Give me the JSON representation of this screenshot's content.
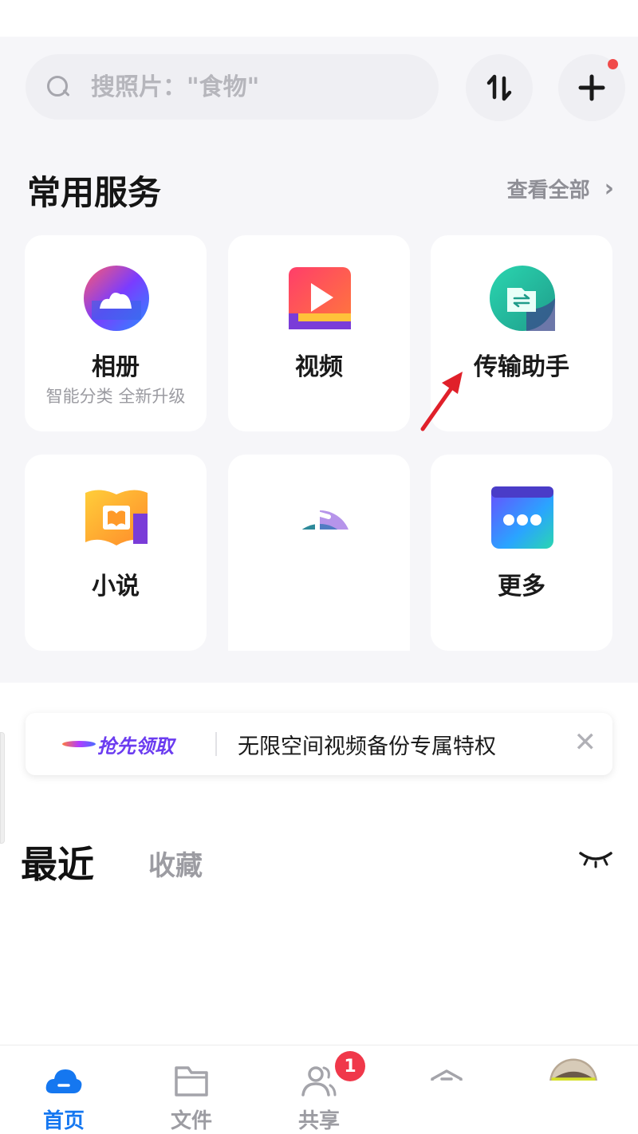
{
  "search": {
    "placeholder": "搜照片：\"食物\""
  },
  "header": {
    "sort_icon": "sort-arrows-icon",
    "add_icon": "plus-icon",
    "add_badge_color": "#f04a4a"
  },
  "services": {
    "title": "常用服务",
    "view_all": "查看全部",
    "items": [
      {
        "name": "相册",
        "sub": "智能分类 全新升级",
        "icon": "album-icon"
      },
      {
        "name": "视频",
        "sub": "",
        "icon": "video-icon"
      },
      {
        "name": "传输助手",
        "sub": "",
        "icon": "transfer-icon"
      },
      {
        "name": "小说",
        "sub": "",
        "icon": "novel-icon"
      },
      {
        "name": "",
        "sub": "",
        "icon": "music-icon"
      },
      {
        "name": "更多",
        "sub": "",
        "icon": "more-icon"
      }
    ]
  },
  "banner": {
    "brand": "抢先领取",
    "text": "无限空间视频备份专属特权",
    "close": "✕"
  },
  "recent_tabs": {
    "recent": "最近",
    "favorites": "收藏"
  },
  "bottom_nav": {
    "items": [
      {
        "label": "首页",
        "icon": "home-cloud-icon",
        "active": true
      },
      {
        "label": "文件",
        "icon": "folder-icon",
        "active": false
      },
      {
        "label": "共享",
        "icon": "share-people-icon",
        "active": false
      },
      {
        "label": "",
        "icon": "box-icon",
        "active": false
      },
      {
        "label": "",
        "icon": "avatar",
        "active": false
      }
    ],
    "share_badge": "1"
  },
  "colors": {
    "accent": "#1577f0",
    "badge": "#f0384a",
    "arrow": "#e0202a"
  }
}
